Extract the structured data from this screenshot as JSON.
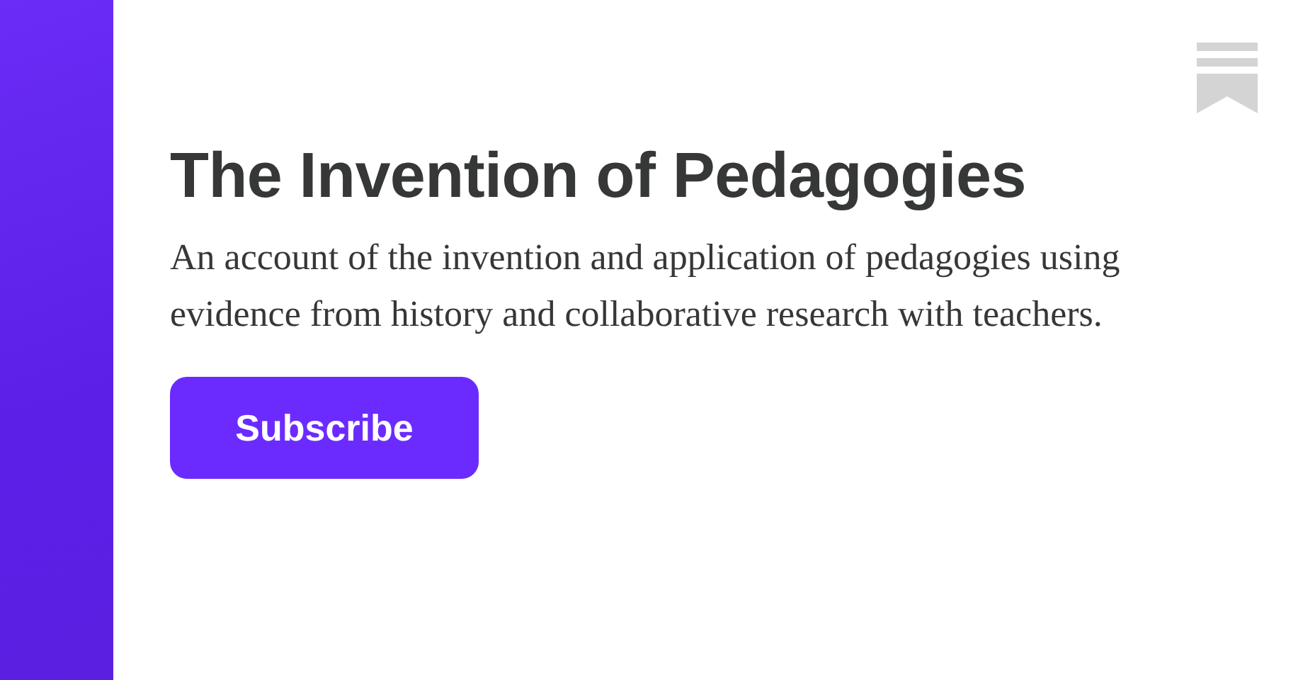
{
  "title": "The Invention of Pedagogies",
  "description": "An account of the invention and application of pedagogies using evidence from history and collaborative research with teachers.",
  "subscribe_button": {
    "label": "Subscribe"
  }
}
